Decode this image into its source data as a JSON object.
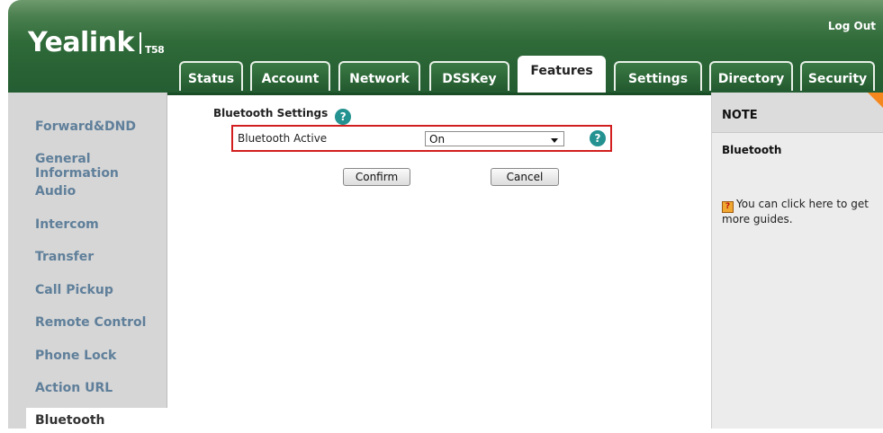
{
  "header": {
    "logo_text": "Yealink",
    "model": "T58",
    "logout_label": "Log Out"
  },
  "tabs": [
    {
      "label": "Status"
    },
    {
      "label": "Account"
    },
    {
      "label": "Network"
    },
    {
      "label": "DSSKey"
    },
    {
      "label": "Features",
      "active": true
    },
    {
      "label": "Settings"
    },
    {
      "label": "Directory"
    },
    {
      "label": "Security"
    }
  ],
  "sidebar": {
    "items": [
      {
        "label": "Forward&DND"
      },
      {
        "label": "General Information"
      },
      {
        "label": "Audio"
      },
      {
        "label": "Intercom"
      },
      {
        "label": "Transfer"
      },
      {
        "label": "Call Pickup"
      },
      {
        "label": "Remote Control"
      },
      {
        "label": "Phone Lock"
      },
      {
        "label": "Action URL"
      },
      {
        "label": "Bluetooth",
        "active": true
      }
    ]
  },
  "content": {
    "section_title": "Bluetooth Settings",
    "bluetooth_active_label": "Bluetooth Active",
    "bluetooth_active_value": "On",
    "confirm_label": "Confirm",
    "cancel_label": "Cancel"
  },
  "note": {
    "title": "NOTE",
    "subtitle": "Bluetooth",
    "guide_text": "You can click here to get more guides."
  },
  "colors": {
    "header_green": "#245d31",
    "sidebar_link": "#5f7f9a",
    "help_icon": "#239290",
    "highlight_border": "#d21e1e",
    "note_corner": "#f5871f"
  }
}
